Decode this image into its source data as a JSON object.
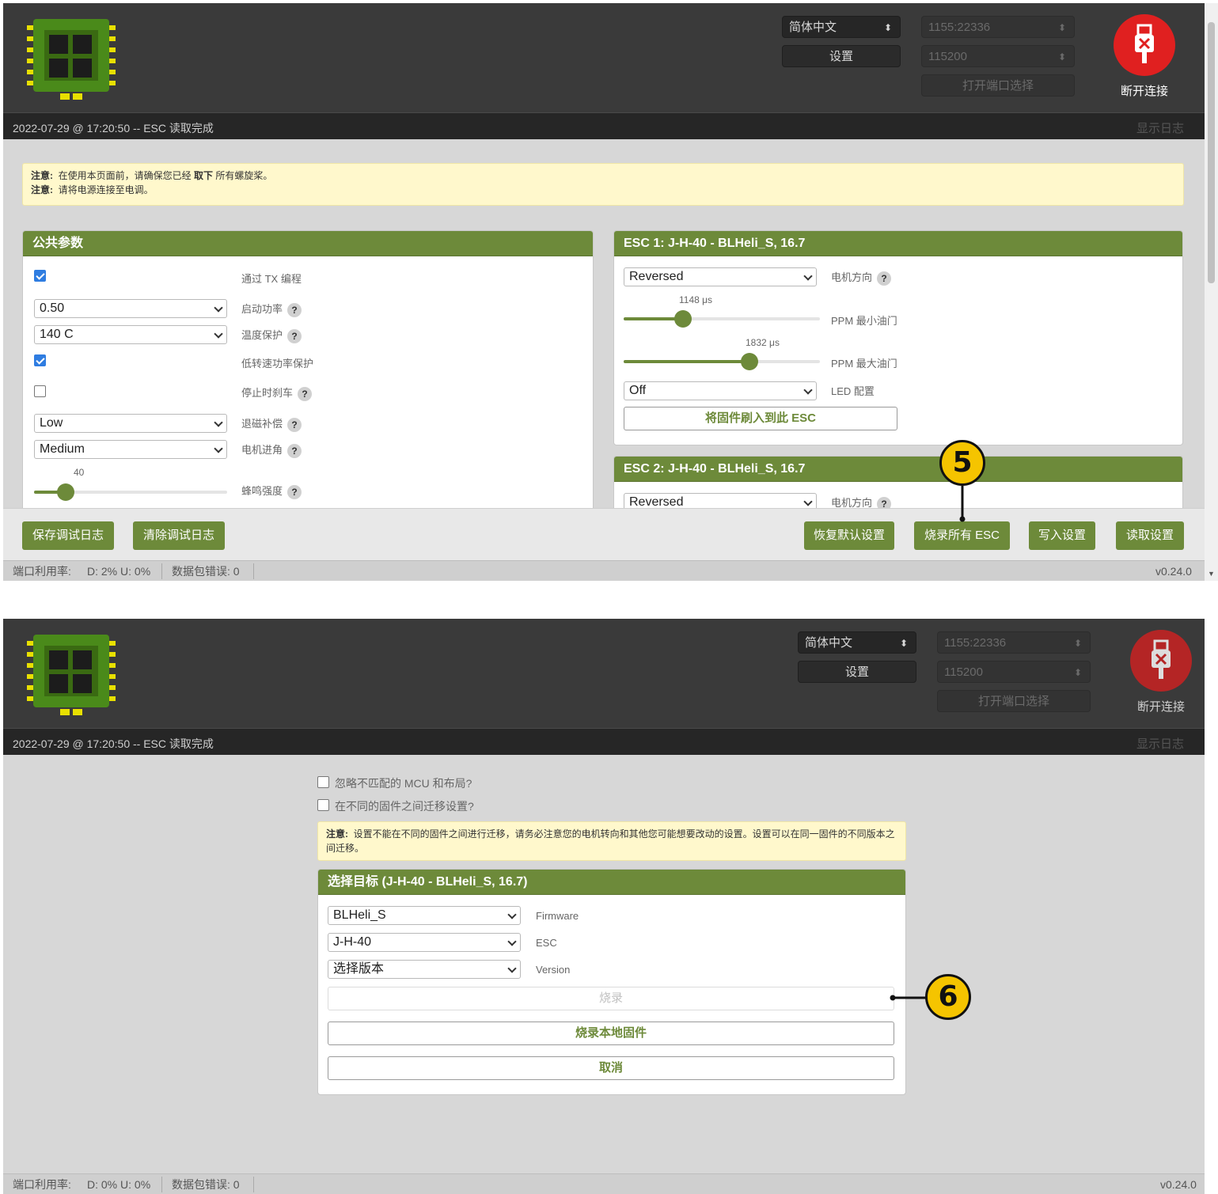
{
  "screen1": {
    "header": {
      "language": "简体中文",
      "settings_label": "设置",
      "port": "1155:22336",
      "baud": "115200",
      "open_port_label": "打开端口选择",
      "disconnect_label": "断开连接"
    },
    "log": {
      "message": "2022-07-29 @ 17:20:50 -- ESC 读取完成",
      "show_log": "显示日志"
    },
    "notice": {
      "prefix": "注意:",
      "line1_a": "在使用本页面前，请确保您已经",
      "line1_bold": "取下",
      "line1_b": "所有螺旋桨。",
      "line2": "请将电源连接至电调。"
    },
    "common": {
      "title": "公共参数",
      "tx_program_label": "通过 TX 编程",
      "startup_power_value": "0.50",
      "startup_power_label": "启动功率",
      "temp_protect_value": "140 C",
      "temp_protect_label": "温度保护",
      "low_rpm_protect_label": "低转速功率保护",
      "brake_on_stop_label": "停止时刹车",
      "demag_value": "Low",
      "demag_label": "退磁补偿",
      "timing_value": "Medium",
      "timing_label": "电机进角",
      "beep_value": "40",
      "beep_label": "蜂鸣强度"
    },
    "esc1": {
      "title": "ESC 1: J-H-40 - BLHeli_S, 16.7",
      "direction_value": "Reversed",
      "direction_label": "电机方向",
      "ppm_min_value": "1148 μs",
      "ppm_min_label": "PPM 最小油门",
      "ppm_max_value": "1832 μs",
      "ppm_max_label": "PPM 最大油门",
      "led_value": "Off",
      "led_label": "LED 配置",
      "flash_button": "将固件刷入到此 ESC"
    },
    "esc2": {
      "title": "ESC 2: J-H-40 - BLHeli_S, 16.7",
      "direction_value": "Reversed",
      "direction_label": "电机方向"
    },
    "footer": {
      "save_log": "保存调试日志",
      "clear_log": "清除调试日志",
      "restore_defaults": "恢复默认设置",
      "flash_all": "烧录所有 ESC",
      "write": "写入设置",
      "read": "读取设置"
    },
    "status": {
      "port_usage": "端口利用率:",
      "usage_value": "D: 2% U: 0%",
      "packet_errors": "数据包错误: 0",
      "version": "v0.24.0"
    },
    "marker": "5"
  },
  "screen2": {
    "header": {
      "language": "简体中文",
      "settings_label": "设置",
      "port": "1155:22336",
      "baud": "115200",
      "open_port_label": "打开端口选择",
      "disconnect_label": "断开连接"
    },
    "log": {
      "message": "2022-07-29 @ 17:20:50 -- ESC 读取完成",
      "show_log": "显示日志"
    },
    "options": {
      "ignore_mcu": "忽略不匹配的 MCU 和布局?",
      "migrate": "在不同的固件之间迁移设置?"
    },
    "notice": {
      "prefix": "注意:",
      "text": "设置不能在不同的固件之间进行迁移，请务必注意您的电机转向和其他您可能想要改动的设置。设置可以在同一固件的不同版本之间迁移。"
    },
    "target": {
      "title": "选择目标 (J-H-40 - BLHeli_S, 16.7)",
      "firmware_value": "BLHeli_S",
      "firmware_label": "Firmware",
      "esc_value": "J-H-40",
      "esc_label": "ESC",
      "version_value": "选择版本",
      "version_label": "Version",
      "flash": "烧录",
      "flash_local": "烧录本地固件",
      "cancel": "取消"
    },
    "status": {
      "port_usage": "端口利用率:",
      "usage_value": "D: 0% U: 0%",
      "packet_errors": "数据包错误: 0",
      "version": "v0.24.0"
    },
    "marker": "6"
  },
  "colors": {
    "accent_green": "#6d8a3a",
    "disconnect_red": "#e02020",
    "marker_yellow": "#f5c400",
    "notice_bg": "#fff8cc"
  },
  "icons": [
    "esc-board-logo-icon",
    "usb-disconnect-icon",
    "help-icon",
    "chevron-down-icon",
    "updown-arrows-icon"
  ]
}
